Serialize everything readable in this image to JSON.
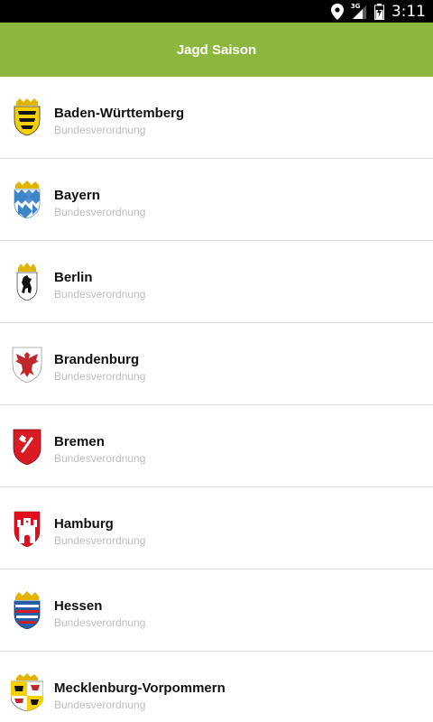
{
  "status_bar": {
    "time": "3:11",
    "network_label": "3G",
    "icons": [
      "location-pin-icon",
      "signal-icon",
      "battery-icon"
    ]
  },
  "app_bar": {
    "title": "Jagd Saison",
    "color": "#8db63c"
  },
  "states": [
    {
      "name": "Baden-Württemberg",
      "subtitle": "Bundesverordnung",
      "icon": "baden-wuerttemberg-crest-icon"
    },
    {
      "name": "Bayern",
      "subtitle": "Bundesverordnung",
      "icon": "bayern-crest-icon"
    },
    {
      "name": "Berlin",
      "subtitle": "Bundesverordnung",
      "icon": "berlin-crest-icon"
    },
    {
      "name": "Brandenburg",
      "subtitle": "Bundesverordnung",
      "icon": "brandenburg-crest-icon"
    },
    {
      "name": "Bremen",
      "subtitle": "Bundesverordnung",
      "icon": "bremen-crest-icon"
    },
    {
      "name": "Hamburg",
      "subtitle": "Bundesverordnung",
      "icon": "hamburg-crest-icon"
    },
    {
      "name": "Hessen",
      "subtitle": "Bundesverordnung",
      "icon": "hessen-crest-icon"
    },
    {
      "name": "Mecklenburg-Vorpommern",
      "subtitle": "Bundesverordnung",
      "icon": "mecklenburg-vorpommern-crest-icon"
    }
  ]
}
